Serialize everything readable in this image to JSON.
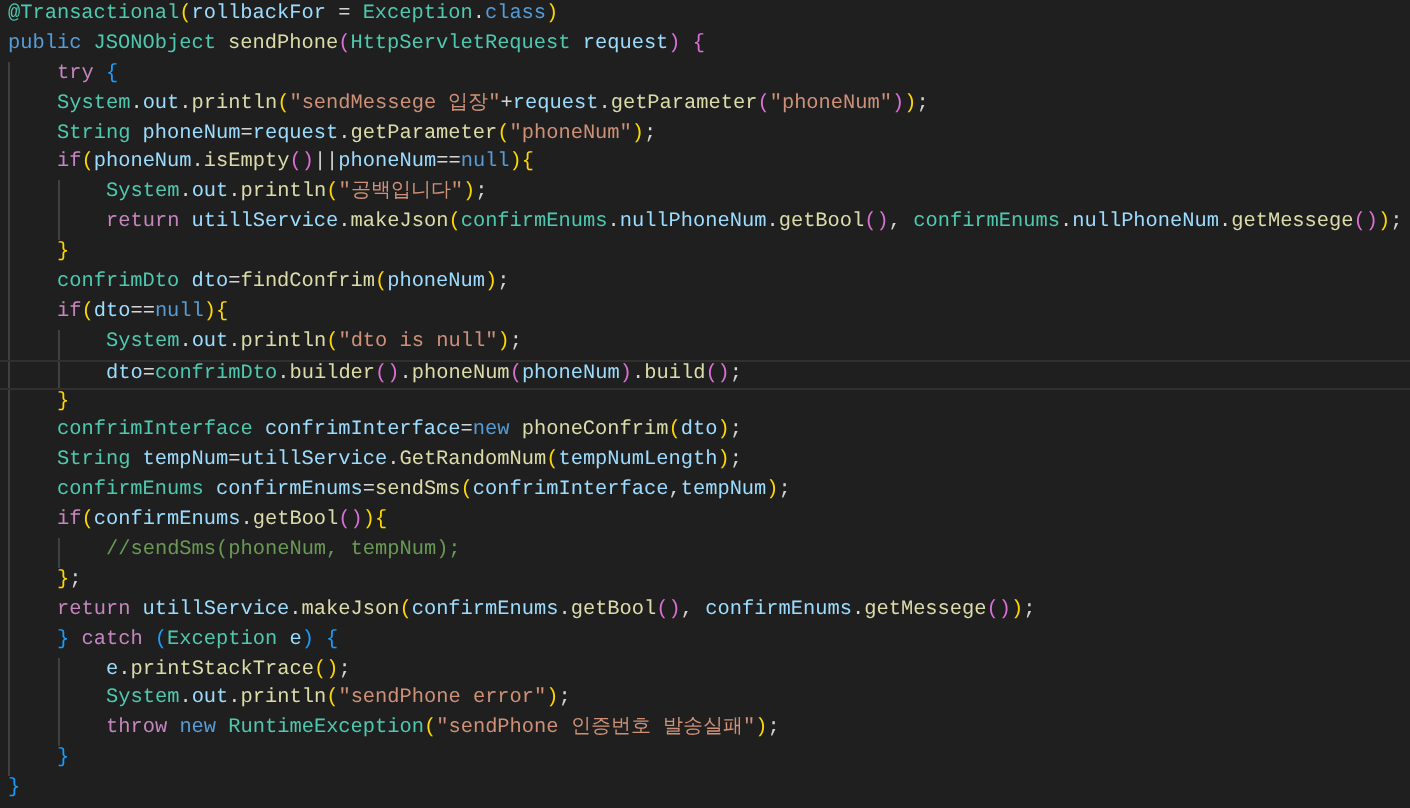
{
  "editor": {
    "lines": [
      {
        "current": false,
        "tokens": [
          {
            "kind": "type",
            "text": "@Transactional"
          },
          {
            "kind": "b1",
            "text": "("
          },
          {
            "kind": "var",
            "text": "rollbackFor"
          },
          {
            "kind": "plain",
            "text": " = "
          },
          {
            "kind": "type",
            "text": "Exception"
          },
          {
            "kind": "plain",
            "text": "."
          },
          {
            "kind": "kw",
            "text": "class"
          },
          {
            "kind": "b1",
            "text": ")"
          }
        ]
      },
      {
        "current": false,
        "tokens": [
          {
            "kind": "kw",
            "text": "public "
          },
          {
            "kind": "type",
            "text": "JSONObject "
          },
          {
            "kind": "fn",
            "text": "sendPhone"
          },
          {
            "kind": "b2",
            "text": "("
          },
          {
            "kind": "type",
            "text": "HttpServletRequest "
          },
          {
            "kind": "var",
            "text": "request"
          },
          {
            "kind": "b2",
            "text": ") "
          },
          {
            "kind": "b2",
            "text": "{"
          }
        ],
        "children": [
          {
            "current": false,
            "tokens": [
              {
                "kind": "ctrl",
                "text": "try "
              },
              {
                "kind": "b3",
                "text": "{"
              }
            ]
          },
          {
            "current": false,
            "tokens": [
              {
                "kind": "type",
                "text": "System"
              },
              {
                "kind": "plain",
                "text": "."
              },
              {
                "kind": "var",
                "text": "out"
              },
              {
                "kind": "plain",
                "text": "."
              },
              {
                "kind": "fn",
                "text": "println"
              },
              {
                "kind": "b1",
                "text": "("
              },
              {
                "kind": "str",
                "text": "\"sendMessege 입장\""
              },
              {
                "kind": "plain",
                "text": "+"
              },
              {
                "kind": "var",
                "text": "request"
              },
              {
                "kind": "plain",
                "text": "."
              },
              {
                "kind": "fn",
                "text": "getParameter"
              },
              {
                "kind": "b2",
                "text": "("
              },
              {
                "kind": "str",
                "text": "\"phoneNum\""
              },
              {
                "kind": "b2",
                "text": ")"
              },
              {
                "kind": "b1",
                "text": ")"
              },
              {
                "kind": "plain",
                "text": ";"
              }
            ]
          },
          {
            "current": false,
            "tokens": [
              {
                "kind": "type",
                "text": "String "
              },
              {
                "kind": "var",
                "text": "phoneNum"
              },
              {
                "kind": "plain",
                "text": "="
              },
              {
                "kind": "var",
                "text": "request"
              },
              {
                "kind": "plain",
                "text": "."
              },
              {
                "kind": "fn",
                "text": "getParameter"
              },
              {
                "kind": "b1",
                "text": "("
              },
              {
                "kind": "str",
                "text": "\"phoneNum\""
              },
              {
                "kind": "b1",
                "text": ")"
              },
              {
                "kind": "plain",
                "text": ";"
              }
            ]
          },
          {
            "current": false,
            "tokens": [
              {
                "kind": "ctrl",
                "text": "if"
              },
              {
                "kind": "b1",
                "text": "("
              },
              {
                "kind": "var",
                "text": "phoneNum"
              },
              {
                "kind": "plain",
                "text": "."
              },
              {
                "kind": "fn",
                "text": "isEmpty"
              },
              {
                "kind": "b2",
                "text": "()"
              },
              {
                "kind": "plain",
                "text": "||"
              },
              {
                "kind": "var",
                "text": "phoneNum"
              },
              {
                "kind": "plain",
                "text": "=="
              },
              {
                "kind": "kw",
                "text": "null"
              },
              {
                "kind": "b1",
                "text": ")"
              },
              {
                "kind": "b1",
                "text": "{"
              }
            ],
            "children": [
              {
                "current": false,
                "tokens": [
                  {
                    "kind": "type",
                    "text": "System"
                  },
                  {
                    "kind": "plain",
                    "text": "."
                  },
                  {
                    "kind": "var",
                    "text": "out"
                  },
                  {
                    "kind": "plain",
                    "text": "."
                  },
                  {
                    "kind": "fn",
                    "text": "println"
                  },
                  {
                    "kind": "b1",
                    "text": "("
                  },
                  {
                    "kind": "str",
                    "text": "\"공백입니다\""
                  },
                  {
                    "kind": "b1",
                    "text": ")"
                  },
                  {
                    "kind": "plain",
                    "text": ";"
                  }
                ]
              },
              {
                "current": false,
                "tokens": [
                  {
                    "kind": "ctrl",
                    "text": "return "
                  },
                  {
                    "kind": "var",
                    "text": "utillService"
                  },
                  {
                    "kind": "plain",
                    "text": "."
                  },
                  {
                    "kind": "fn",
                    "text": "makeJson"
                  },
                  {
                    "kind": "b1",
                    "text": "("
                  },
                  {
                    "kind": "type",
                    "text": "confirmEnums"
                  },
                  {
                    "kind": "plain",
                    "text": "."
                  },
                  {
                    "kind": "var",
                    "text": "nullPhoneNum"
                  },
                  {
                    "kind": "plain",
                    "text": "."
                  },
                  {
                    "kind": "fn",
                    "text": "getBool"
                  },
                  {
                    "kind": "b2",
                    "text": "()"
                  },
                  {
                    "kind": "plain",
                    "text": ", "
                  },
                  {
                    "kind": "type",
                    "text": "confirmEnums"
                  },
                  {
                    "kind": "plain",
                    "text": "."
                  },
                  {
                    "kind": "var",
                    "text": "nullPhoneNum"
                  },
                  {
                    "kind": "plain",
                    "text": "."
                  },
                  {
                    "kind": "fn",
                    "text": "getMessege"
                  },
                  {
                    "kind": "b2",
                    "text": "()"
                  },
                  {
                    "kind": "b1",
                    "text": ")"
                  },
                  {
                    "kind": "plain",
                    "text": ";"
                  }
                ]
              }
            ]
          },
          {
            "current": false,
            "tokens": [
              {
                "kind": "b1",
                "text": "}"
              }
            ]
          },
          {
            "current": false,
            "tokens": [
              {
                "kind": "type",
                "text": "confrimDto "
              },
              {
                "kind": "var",
                "text": "dto"
              },
              {
                "kind": "plain",
                "text": "="
              },
              {
                "kind": "fn",
                "text": "findConfrim"
              },
              {
                "kind": "b1",
                "text": "("
              },
              {
                "kind": "var",
                "text": "phoneNum"
              },
              {
                "kind": "b1",
                "text": ")"
              },
              {
                "kind": "plain",
                "text": ";"
              }
            ]
          },
          {
            "current": false,
            "tokens": [
              {
                "kind": "ctrl",
                "text": "if"
              },
              {
                "kind": "b1",
                "text": "("
              },
              {
                "kind": "var",
                "text": "dto"
              },
              {
                "kind": "plain",
                "text": "=="
              },
              {
                "kind": "kw",
                "text": "null"
              },
              {
                "kind": "b1",
                "text": ")"
              },
              {
                "kind": "b1",
                "text": "{"
              }
            ],
            "children": [
              {
                "current": false,
                "tokens": [
                  {
                    "kind": "type",
                    "text": "System"
                  },
                  {
                    "kind": "plain",
                    "text": "."
                  },
                  {
                    "kind": "var",
                    "text": "out"
                  },
                  {
                    "kind": "plain",
                    "text": "."
                  },
                  {
                    "kind": "fn",
                    "text": "println"
                  },
                  {
                    "kind": "b1",
                    "text": "("
                  },
                  {
                    "kind": "str",
                    "text": "\"dto is null\""
                  },
                  {
                    "kind": "b1",
                    "text": ")"
                  },
                  {
                    "kind": "plain",
                    "text": ";"
                  }
                ]
              },
              {
                "current": true,
                "tokens": [
                  {
                    "kind": "var",
                    "text": "dto"
                  },
                  {
                    "kind": "plain",
                    "text": "="
                  },
                  {
                    "kind": "type",
                    "text": "confrimDto"
                  },
                  {
                    "kind": "plain",
                    "text": "."
                  },
                  {
                    "kind": "fn",
                    "text": "builder"
                  },
                  {
                    "kind": "b2",
                    "text": "()"
                  },
                  {
                    "kind": "plain",
                    "text": "."
                  },
                  {
                    "kind": "fn",
                    "text": "phoneNum"
                  },
                  {
                    "kind": "b2",
                    "text": "("
                  },
                  {
                    "kind": "var",
                    "text": "phoneNum"
                  },
                  {
                    "kind": "b2",
                    "text": ")"
                  },
                  {
                    "kind": "plain",
                    "text": "."
                  },
                  {
                    "kind": "fn",
                    "text": "build"
                  },
                  {
                    "kind": "b2",
                    "text": "()"
                  },
                  {
                    "kind": "plain",
                    "text": ";"
                  }
                ]
              }
            ]
          },
          {
            "current": false,
            "tokens": [
              {
                "kind": "b1",
                "text": "}"
              }
            ]
          },
          {
            "current": false,
            "tokens": [
              {
                "kind": "type",
                "text": "confrimInterface "
              },
              {
                "kind": "var",
                "text": "confrimInterface"
              },
              {
                "kind": "plain",
                "text": "="
              },
              {
                "kind": "kw",
                "text": "new "
              },
              {
                "kind": "fn",
                "text": "phoneConfrim"
              },
              {
                "kind": "b1",
                "text": "("
              },
              {
                "kind": "var",
                "text": "dto"
              },
              {
                "kind": "b1",
                "text": ")"
              },
              {
                "kind": "plain",
                "text": ";"
              }
            ]
          },
          {
            "current": false,
            "tokens": [
              {
                "kind": "type",
                "text": "String "
              },
              {
                "kind": "var",
                "text": "tempNum"
              },
              {
                "kind": "plain",
                "text": "="
              },
              {
                "kind": "var",
                "text": "utillService"
              },
              {
                "kind": "plain",
                "text": "."
              },
              {
                "kind": "fn",
                "text": "GetRandomNum"
              },
              {
                "kind": "b1",
                "text": "("
              },
              {
                "kind": "var",
                "text": "tempNumLength"
              },
              {
                "kind": "b1",
                "text": ")"
              },
              {
                "kind": "plain",
                "text": ";"
              }
            ]
          },
          {
            "current": false,
            "tokens": [
              {
                "kind": "type",
                "text": "confirmEnums "
              },
              {
                "kind": "var",
                "text": "confirmEnums"
              },
              {
                "kind": "plain",
                "text": "="
              },
              {
                "kind": "fn",
                "text": "sendSms"
              },
              {
                "kind": "b1",
                "text": "("
              },
              {
                "kind": "var",
                "text": "confrimInterface"
              },
              {
                "kind": "plain",
                "text": ","
              },
              {
                "kind": "var",
                "text": "tempNum"
              },
              {
                "kind": "b1",
                "text": ")"
              },
              {
                "kind": "plain",
                "text": ";"
              }
            ]
          },
          {
            "current": false,
            "tokens": [
              {
                "kind": "ctrl",
                "text": "if"
              },
              {
                "kind": "b1",
                "text": "("
              },
              {
                "kind": "var",
                "text": "confirmEnums"
              },
              {
                "kind": "plain",
                "text": "."
              },
              {
                "kind": "fn",
                "text": "getBool"
              },
              {
                "kind": "b2",
                "text": "()"
              },
              {
                "kind": "b1",
                "text": ")"
              },
              {
                "kind": "b1",
                "text": "{"
              }
            ],
            "children": [
              {
                "current": false,
                "tokens": [
                  {
                    "kind": "cm",
                    "text": "//sendSms(phoneNum, tempNum);"
                  }
                ]
              }
            ]
          },
          {
            "current": false,
            "tokens": [
              {
                "kind": "b1",
                "text": "}"
              },
              {
                "kind": "plain",
                "text": ";"
              }
            ]
          },
          {
            "current": false,
            "tokens": [
              {
                "kind": "ctrl",
                "text": "return "
              },
              {
                "kind": "var",
                "text": "utillService"
              },
              {
                "kind": "plain",
                "text": "."
              },
              {
                "kind": "fn",
                "text": "makeJson"
              },
              {
                "kind": "b1",
                "text": "("
              },
              {
                "kind": "var",
                "text": "confirmEnums"
              },
              {
                "kind": "plain",
                "text": "."
              },
              {
                "kind": "fn",
                "text": "getBool"
              },
              {
                "kind": "b2",
                "text": "()"
              },
              {
                "kind": "plain",
                "text": ", "
              },
              {
                "kind": "var",
                "text": "confirmEnums"
              },
              {
                "kind": "plain",
                "text": "."
              },
              {
                "kind": "fn",
                "text": "getMessege"
              },
              {
                "kind": "b2",
                "text": "()"
              },
              {
                "kind": "b1",
                "text": ")"
              },
              {
                "kind": "plain",
                "text": ";"
              }
            ]
          },
          {
            "current": false,
            "tokens": [
              {
                "kind": "b3",
                "text": "} "
              },
              {
                "kind": "ctrl",
                "text": "catch "
              },
              {
                "kind": "b3",
                "text": "("
              },
              {
                "kind": "type",
                "text": "Exception "
              },
              {
                "kind": "var",
                "text": "e"
              },
              {
                "kind": "b3",
                "text": ") "
              },
              {
                "kind": "b3",
                "text": "{"
              }
            ],
            "children": [
              {
                "current": false,
                "tokens": [
                  {
                    "kind": "var",
                    "text": "e"
                  },
                  {
                    "kind": "plain",
                    "text": "."
                  },
                  {
                    "kind": "fn",
                    "text": "printStackTrace"
                  },
                  {
                    "kind": "b1",
                    "text": "()"
                  },
                  {
                    "kind": "plain",
                    "text": ";"
                  }
                ]
              },
              {
                "current": false,
                "tokens": [
                  {
                    "kind": "type",
                    "text": "System"
                  },
                  {
                    "kind": "plain",
                    "text": "."
                  },
                  {
                    "kind": "var",
                    "text": "out"
                  },
                  {
                    "kind": "plain",
                    "text": "."
                  },
                  {
                    "kind": "fn",
                    "text": "println"
                  },
                  {
                    "kind": "b1",
                    "text": "("
                  },
                  {
                    "kind": "str",
                    "text": "\"sendPhone error\""
                  },
                  {
                    "kind": "b1",
                    "text": ")"
                  },
                  {
                    "kind": "plain",
                    "text": ";"
                  }
                ]
              },
              {
                "current": false,
                "tokens": [
                  {
                    "kind": "ctrl",
                    "text": "throw "
                  },
                  {
                    "kind": "kw",
                    "text": "new "
                  },
                  {
                    "kind": "type",
                    "text": "RuntimeException"
                  },
                  {
                    "kind": "b1",
                    "text": "("
                  },
                  {
                    "kind": "str",
                    "text": "\"sendPhone 인증번호 발송실패\""
                  },
                  {
                    "kind": "b1",
                    "text": ")"
                  },
                  {
                    "kind": "plain",
                    "text": ";"
                  }
                ]
              }
            ]
          },
          {
            "current": false,
            "tokens": [
              {
                "kind": "b3",
                "text": "}"
              }
            ]
          }
        ]
      },
      {
        "current": false,
        "tokens": [
          {
            "kind": "b3",
            "text": "}"
          }
        ]
      }
    ]
  }
}
